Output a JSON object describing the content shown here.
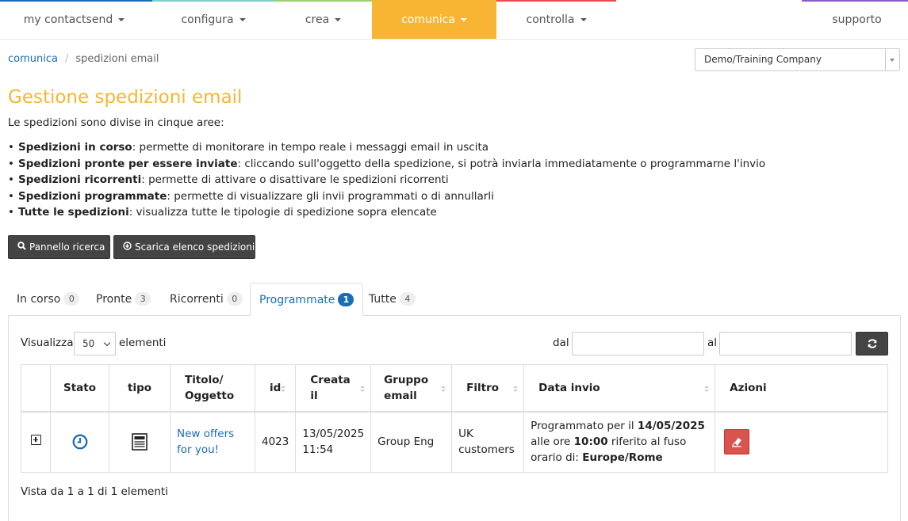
{
  "nav": {
    "strip_colors": [
      "#1a6db5",
      "#7fd0c9",
      "#9ccf6e",
      "#f8b533",
      "#e84c4c",
      "#ffffff",
      "#8a5cc7"
    ],
    "items": [
      {
        "label": "my contactsend"
      },
      {
        "label": "configura"
      },
      {
        "label": "crea"
      },
      {
        "label": "comunica"
      },
      {
        "label": "controlla"
      }
    ],
    "support": "supporto"
  },
  "breadcrumb": {
    "root": "comunica",
    "sep": "/",
    "current": "spedizioni email"
  },
  "company_select": {
    "value": "Demo/Training Company"
  },
  "page": {
    "title": "Gestione spedizioni email",
    "intro": "Le spedizioni sono divise in cinque aree:",
    "bullets": [
      {
        "term": "Spedizioni in corso",
        "desc": ": permette di monitorare in tempo reale i messaggi email in uscita"
      },
      {
        "term": "Spedizioni pronte per essere inviate",
        "desc": ": cliccando sull'oggetto della spedizione, si potrà inviarla immediatamente o programmarne l'invio"
      },
      {
        "term": "Spedizioni ricorrenti",
        "desc": ": permette di attivare o disattivare le spedizioni ricorrenti"
      },
      {
        "term": "Spedizioni programmate",
        "desc": ": permette di visualizzare gli invii programmati o di annullarli"
      },
      {
        "term": "Tutte le spedizioni",
        "desc": ": visualizza tutte le tipologie di spedizione sopra elencate"
      }
    ]
  },
  "toolbar": {
    "search_panel": "Pannello ricerca",
    "download_list": "Scarica elenco spedizioni"
  },
  "tabs": [
    {
      "label": "In corso",
      "count": "0"
    },
    {
      "label": "Pronte",
      "count": "3"
    },
    {
      "label": "Ricorrenti",
      "count": "0"
    },
    {
      "label": "Programmate",
      "count": "1"
    },
    {
      "label": "Tutte",
      "count": "4"
    }
  ],
  "filters": {
    "show_label": "Visualizza",
    "page_size": "50",
    "elements_label": "elementi",
    "from_label": "dal",
    "to_label": "al"
  },
  "table": {
    "headers": {
      "stato": "Stato",
      "tipo": "tipo",
      "titolo_1": "Titolo/",
      "titolo_2": "Oggetto",
      "id": "id",
      "creata_1": "Creata",
      "creata_2": "il",
      "gruppo_1": "Gruppo",
      "gruppo_2": "email",
      "filtro": "Filtro",
      "data_invio": "Data invio",
      "azioni": "Azioni"
    },
    "rows": [
      {
        "title_1": "New offers",
        "title_2": "for you!",
        "id": "4023",
        "created_date": "13/05/2025",
        "created_time": "11:54",
        "group": "Group Eng",
        "filter_1": "UK",
        "filter_2": "customers",
        "send_p1": "Programmato per il ",
        "send_date": "14/05/2025",
        "send_p2": "alle ore ",
        "send_time": "10:00",
        "send_p3": " riferito al fuso",
        "send_p4": "orario di: ",
        "send_tz": "Europe/Rome"
      }
    ]
  },
  "info": "Vista da 1 a 1 di 1 elementi",
  "colors": {
    "accent": "#f8b533",
    "link": "#1a6db5",
    "danger": "#d9534f",
    "dark_button": "#444444"
  }
}
